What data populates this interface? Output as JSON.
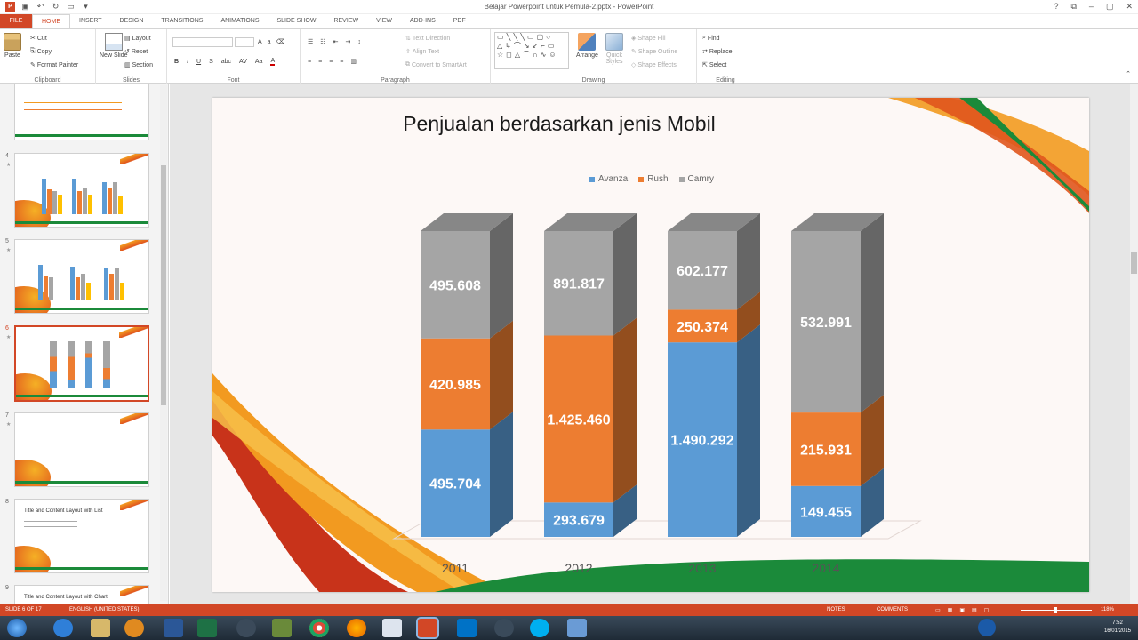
{
  "window": {
    "title": "Belajar Powerpoint untuk Pemula-2.pptx - PowerPoint",
    "controls": [
      "?",
      "⧉",
      "–",
      "▢",
      "✕"
    ]
  },
  "tabs": [
    "FILE",
    "HOME",
    "INSERT",
    "DESIGN",
    "TRANSITIONS",
    "ANIMATIONS",
    "SLIDE SHOW",
    "REVIEW",
    "VIEW",
    "ADD-INS",
    "PDF"
  ],
  "active_tab": "HOME",
  "ribbon": {
    "clipboard": {
      "paste": "Paste",
      "cut": "Cut",
      "copy": "Copy",
      "format_painter": "Format Painter",
      "label": "Clipboard"
    },
    "slides": {
      "new_slide": "New Slide",
      "layout": "Layout",
      "reset": "Reset",
      "section": "Section",
      "label": "Slides"
    },
    "font": {
      "label": "Font"
    },
    "paragraph": {
      "text_direction": "Text Direction",
      "align_text": "Align Text",
      "smartart": "Convert to SmartArt",
      "label": "Paragraph"
    },
    "drawing": {
      "arrange": "Arrange",
      "quick_styles": "Quick Styles",
      "shape_fill": "Shape Fill",
      "shape_outline": "Shape Outline",
      "shape_effects": "Shape Effects",
      "label": "Drawing"
    },
    "editing": {
      "find": "Find",
      "replace": "Replace",
      "select": "Select",
      "label": "Editing"
    }
  },
  "thumbnails": [
    {
      "num": "4",
      "title": ""
    },
    {
      "num": "5",
      "title": ""
    },
    {
      "num": "6",
      "title": "",
      "selected": true
    },
    {
      "num": "7",
      "title": ""
    },
    {
      "num": "8",
      "title": "Title and Content Layout with List"
    },
    {
      "num": "9",
      "title": "Title and Content Layout with Chart"
    }
  ],
  "slide": {
    "title": "Penjualan berdasarkan jenis Mobil"
  },
  "chart_data": {
    "type": "bar",
    "stacked": true,
    "three_d": true,
    "title": "Penjualan berdasarkan jenis Mobil",
    "categories": [
      "2011",
      "2012",
      "2013",
      "2014"
    ],
    "series": [
      {
        "name": "Avanza",
        "color": "#5b9bd5",
        "values": [
          495704,
          293679,
          1490292,
          149455
        ],
        "labels": [
          "495.704",
          "293.679",
          "1.490.292",
          "149.455"
        ]
      },
      {
        "name": "Rush",
        "color": "#ed7d31",
        "values": [
          420985,
          1425460,
          250374,
          215931
        ],
        "labels": [
          "420.985",
          "1.425.460",
          "250.374",
          "215.931"
        ]
      },
      {
        "name": "Camry",
        "color": "#a5a5a5",
        "values": [
          495608,
          891817,
          602177,
          532991
        ],
        "labels": [
          "495.608",
          "891.817",
          "602.177",
          "532.991"
        ]
      }
    ],
    "legend": "top"
  },
  "statusbar": {
    "slide_info": "SLIDE 6 OF 17",
    "language": "ENGLISH (UNITED STATES)",
    "notes": "NOTES",
    "comments": "COMMENTS",
    "zoom": "118%"
  },
  "clock": {
    "time": "7:52",
    "date": "16/01/2015"
  },
  "colors": {
    "accent": "#d24726",
    "green": "#1b8a3a",
    "avanza": "#5b9bd5",
    "rush": "#ed7d31",
    "camry": "#a5a5a5"
  }
}
